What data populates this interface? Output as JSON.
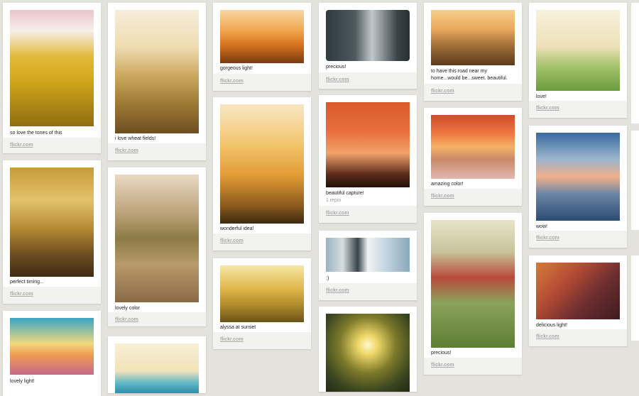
{
  "source_label": "flickr.com",
  "pins": [
    {
      "id": "c1p1",
      "caption": "so love the tones of this"
    },
    {
      "id": "c1p2",
      "caption": "perfect timing..."
    },
    {
      "id": "c1p3",
      "caption": "lovely light!"
    },
    {
      "id": "c2p1",
      "caption": "i love wheat fields!"
    },
    {
      "id": "c2p2",
      "caption": "lovely color"
    },
    {
      "id": "c2p3",
      "caption": ""
    },
    {
      "id": "c3p1",
      "caption": "gorgeous light!"
    },
    {
      "id": "c3p2",
      "caption": "wonderful idea!"
    },
    {
      "id": "c3p3",
      "caption": "alyssa at sunset"
    },
    {
      "id": "c4p1",
      "caption": "precious!"
    },
    {
      "id": "c4p2",
      "caption": "beautiful capture!",
      "repins": "1 repin"
    },
    {
      "id": "c4p3",
      "caption": ":)"
    },
    {
      "id": "c4p4",
      "caption": ""
    },
    {
      "id": "c5p1",
      "caption": "to have this road near my home...would be...sweet. beautiful."
    },
    {
      "id": "c5p2",
      "caption": "amazing color!"
    },
    {
      "id": "c5p3",
      "caption": "precious!"
    },
    {
      "id": "c6p1",
      "caption": "love!"
    },
    {
      "id": "c6p2",
      "caption": "wow!"
    },
    {
      "id": "c6p3",
      "caption": "delicious light!"
    }
  ]
}
